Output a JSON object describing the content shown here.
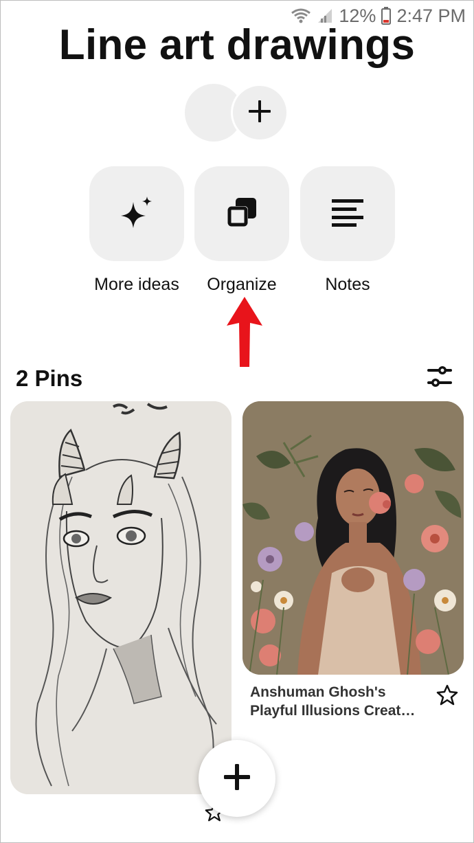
{
  "status_bar": {
    "battery_percent": "12%",
    "time": "2:47 PM",
    "icons": [
      "wifi-icon",
      "signal-icon",
      "battery-icon"
    ]
  },
  "board": {
    "title": "Line art drawings"
  },
  "collaborators": {
    "add_icon": "plus-icon"
  },
  "actions": [
    {
      "label": "More ideas",
      "icon": "sparkle-icon"
    },
    {
      "label": "Organize",
      "icon": "organize-icon"
    },
    {
      "label": "Notes",
      "icon": "notes-icon"
    }
  ],
  "annotation": {
    "arrow_color": "#e8141b"
  },
  "pins_section": {
    "count_label": "2 Pins",
    "filter_icon": "filter-sliders-icon"
  },
  "pins": [
    {
      "title": "",
      "image": "line-art-girl-with-horns"
    },
    {
      "title": "Anshuman Ghosh's Playful Illusions Creat…",
      "image": "illustrated-woman-with-flowers"
    }
  ],
  "fab": {
    "icon": "plus-icon"
  },
  "colors": {
    "tile_bg": "#efefef",
    "text": "#111111",
    "arrow": "#e8141b"
  }
}
